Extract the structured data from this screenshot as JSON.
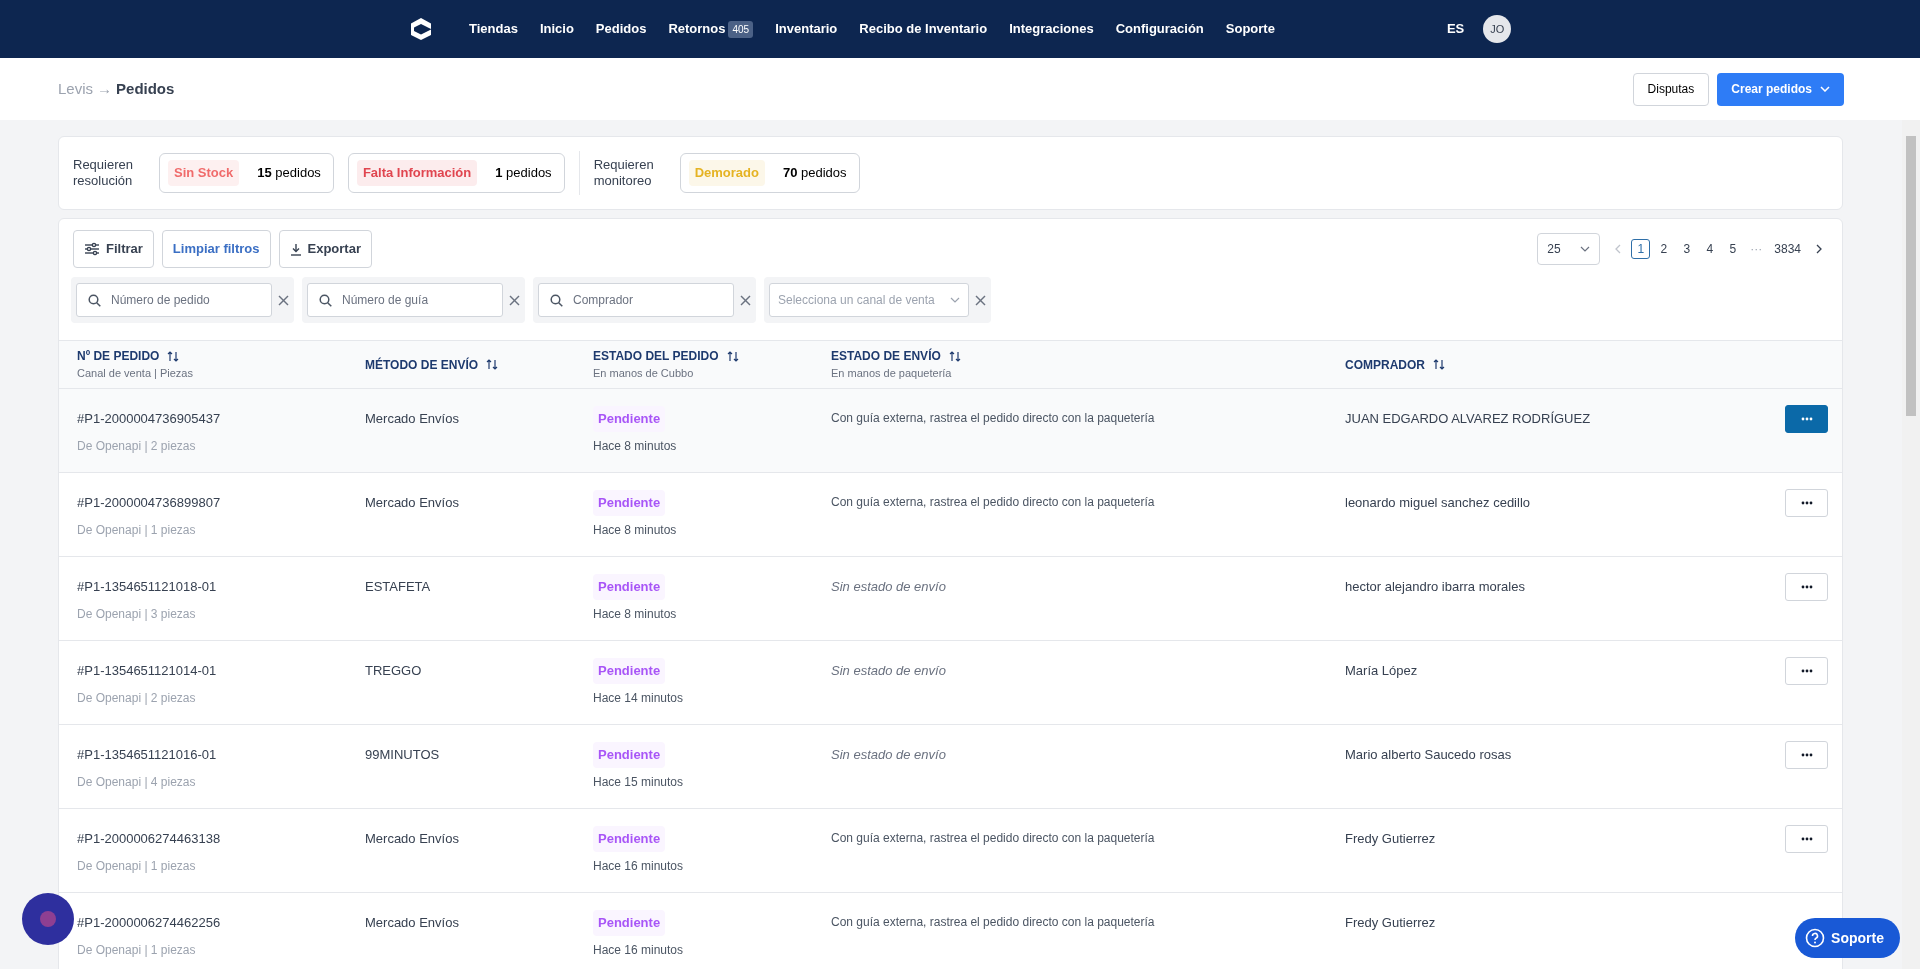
{
  "nav": {
    "items": [
      {
        "label": "Tiendas"
      },
      {
        "label": "Inicio"
      },
      {
        "label": "Pedidos"
      },
      {
        "label": "Retornos",
        "badge": "405"
      },
      {
        "label": "Inventario"
      },
      {
        "label": "Recibo de Inventario"
      },
      {
        "label": "Integraciones"
      },
      {
        "label": "Configuración"
      },
      {
        "label": "Soporte"
      }
    ],
    "language": "ES",
    "avatar": "JO"
  },
  "breadcrumb": {
    "items": [
      "Levis",
      "Pedidos"
    ],
    "separator": "→"
  },
  "header_buttons": {
    "secondary": "Disputas",
    "primary": "Crear pedidos"
  },
  "summary": [
    {
      "label": "Requieren resolución",
      "chips": [
        {
          "tag": "Sin Stock",
          "color": "#f06b6b",
          "count": "15",
          "unit": "pedidos"
        },
        {
          "tag": "Falta Información",
          "color": "#e0454f",
          "count": "1",
          "unit": "pedidos"
        }
      ]
    },
    {
      "label": "Requieren monitoreo",
      "chips": [
        {
          "tag": "Demorado",
          "color": "#e5b323",
          "count": "70",
          "unit": "pedidos"
        }
      ]
    }
  ],
  "toolbar": [
    {
      "kind": "filter",
      "label": "Filtrar"
    },
    {
      "kind": "clear",
      "label": "Limpiar filtros"
    },
    {
      "kind": "export",
      "label": "Exportar"
    }
  ],
  "filters": [
    {
      "kind": "search",
      "placeholder": "Número de pedido"
    },
    {
      "kind": "search",
      "placeholder": "Número de guía"
    },
    {
      "kind": "search",
      "placeholder": "Comprador"
    },
    {
      "kind": "select",
      "placeholder": "Selecciona un canal de venta"
    }
  ],
  "pagination": {
    "page_size": "25",
    "pages": [
      {
        "label": "1",
        "selected": true
      },
      {
        "label": "2",
        "selected": false
      },
      {
        "label": "3",
        "selected": false
      },
      {
        "label": "4",
        "selected": false
      },
      {
        "label": "5",
        "selected": false
      }
    ],
    "ellipsis": "···",
    "last": "3834"
  },
  "table": {
    "columns": [
      {
        "title": "Nº DE PEDIDO",
        "subtitle": "Canal de venta | Piezas"
      },
      {
        "title": "MÉTODO DE ENVÍO"
      },
      {
        "title": "ESTADO DEL PEDIDO",
        "subtitle": "En manos de Cubbo"
      },
      {
        "title": "ESTADO DE ENVÍO",
        "subtitle": "En manos de paquetería"
      },
      {
        "title": "COMPRADOR"
      }
    ],
    "rows": [
      {
        "order": "#P1-2000004736905437",
        "channel": "De Openapi | 2 piezas",
        "method": "Mercado Envíos",
        "status": "Pendiente",
        "time": "Hace 8 minutos",
        "shipping": {
          "kind": "text",
          "text": "Con guía externa, rastrea el pedido directo con la paquetería"
        },
        "buyer": "JUAN EDGARDO ALVAREZ RODRÍGUEZ",
        "highlighted": true
      },
      {
        "order": "#P1-2000004736899807",
        "channel": "De Openapi | 1 piezas",
        "method": "Mercado Envíos",
        "status": "Pendiente",
        "time": "Hace 8 minutos",
        "shipping": {
          "kind": "text",
          "text": "Con guía externa, rastrea el pedido directo con la paquetería"
        },
        "buyer": "leonardo miguel sanchez cedillo",
        "highlighted": false
      },
      {
        "order": "#P1-1354651121018-01",
        "channel": "De Openapi | 3 piezas",
        "method": "ESTAFETA",
        "status": "Pendiente",
        "time": "Hace 8 minutos",
        "shipping": {
          "kind": "empty",
          "text": "Sin estado de envío"
        },
        "buyer": "hector alejandro ibarra morales",
        "highlighted": false
      },
      {
        "order": "#P1-1354651121014-01",
        "channel": "De Openapi | 2 piezas",
        "method": "TREGGO",
        "status": "Pendiente",
        "time": "Hace 14 minutos",
        "shipping": {
          "kind": "empty",
          "text": "Sin estado de envío"
        },
        "buyer": "María López",
        "highlighted": false
      },
      {
        "order": "#P1-1354651121016-01",
        "channel": "De Openapi | 4 piezas",
        "method": "99MINUTOS",
        "status": "Pendiente",
        "time": "Hace 15 minutos",
        "shipping": {
          "kind": "empty",
          "text": "Sin estado de envío"
        },
        "buyer": "Mario alberto Saucedo rosas",
        "highlighted": false
      },
      {
        "order": "#P1-2000006274463138",
        "channel": "De Openapi | 1 piezas",
        "method": "Mercado Envíos",
        "status": "Pendiente",
        "time": "Hace 16 minutos",
        "shipping": {
          "kind": "text",
          "text": "Con guía externa, rastrea el pedido directo con la paquetería"
        },
        "buyer": "Fredy Gutierrez",
        "highlighted": false
      },
      {
        "order": "#P1-2000006274462256",
        "channel": "De Openapi | 1 piezas",
        "method": "Mercado Envíos",
        "status": "Pendiente",
        "time": "Hace 16 minutos",
        "shipping": {
          "kind": "text",
          "text": "Con guía externa, rastrea el pedido directo con la paquetería"
        },
        "buyer": "Fredy Gutierrez",
        "highlighted": false,
        "actions_hidden": true
      }
    ]
  },
  "support_button": "Soporte"
}
